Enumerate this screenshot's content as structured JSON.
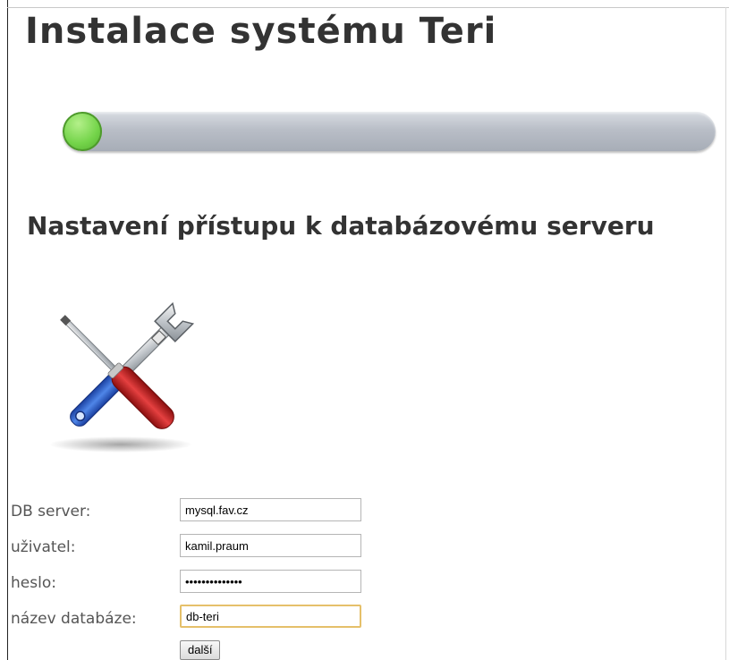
{
  "page": {
    "title": "Instalace systému Teri",
    "section_title": "Nastavení přístupu k databázovému serveru"
  },
  "progress": {
    "value_fraction": 0.05,
    "colors": {
      "fill": "#74d44a",
      "track": "#b9bec7"
    }
  },
  "illustration": {
    "icon": "tools-icon"
  },
  "form": {
    "fields": [
      {
        "label": "DB server:",
        "value": "mysql.fav.cz",
        "type": "text"
      },
      {
        "label": "uživatel:",
        "value": "kamil.praum",
        "type": "text"
      },
      {
        "label": "heslo:",
        "value": "••••••••••••••",
        "type": "password"
      },
      {
        "label": "název databáze:",
        "value": "db-teri",
        "type": "text",
        "focused": true
      }
    ],
    "submit_label": "další"
  }
}
